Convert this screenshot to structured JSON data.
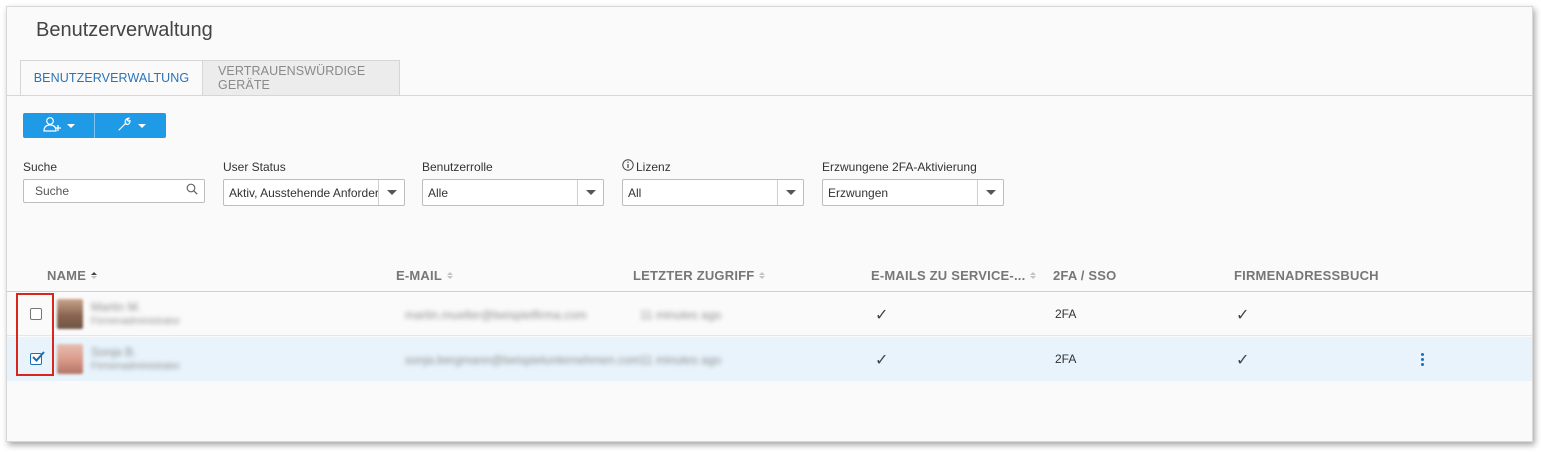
{
  "page": {
    "title": "Benutzerverwaltung"
  },
  "tabs": [
    {
      "label": "BENUTZERVERWALTUNG",
      "active": true
    },
    {
      "label": "VERTRAUENSWÜRDIGE GERÄTE",
      "active": false
    }
  ],
  "toolbar": {
    "add_user_icon": "add-user-icon",
    "tools_icon": "wrench-icon",
    "accent": "#1e9ae6"
  },
  "filters": {
    "search": {
      "label": "Suche",
      "placeholder": "Suche"
    },
    "user_status": {
      "label": "User Status",
      "value": "Aktiv, Ausstehende Anforderung"
    },
    "role": {
      "label": "Benutzerrolle",
      "value": "Alle"
    },
    "license": {
      "label": "Lizenz",
      "value": "All"
    },
    "twofa": {
      "label": "Erzwungene 2FA-Aktivierung",
      "value": "Erzwungen"
    }
  },
  "table": {
    "columns": {
      "name": "NAME",
      "email": "E-MAIL",
      "last_access": "LETZTER ZUGRIFF",
      "service_emails": "E-MAILS ZU SERVICE-...",
      "twofa": "2FA / SSO",
      "address_book": "FIRMENADRESSBUCH"
    },
    "rows": [
      {
        "checked": false,
        "name": "Martin M.",
        "subtitle": "Firmenadministrator",
        "email": "martin.mueller@beispielfirma.com",
        "last_access": "11 minutes ago",
        "service_emails": "✓",
        "twofa": "2FA",
        "address_book": "✓",
        "selected": false
      },
      {
        "checked": true,
        "name": "Sonja B.",
        "subtitle": "Firmenadministrator",
        "email": "sonja.bergmann@beispielunternehmen.com",
        "last_access": "11 minutes ago",
        "service_emails": "✓",
        "twofa": "2FA",
        "address_book": "✓",
        "selected": true
      }
    ]
  },
  "colors": {
    "selected_row": "#e8f3fb",
    "highlight": "#d9261c",
    "link": "#2a74b8"
  }
}
